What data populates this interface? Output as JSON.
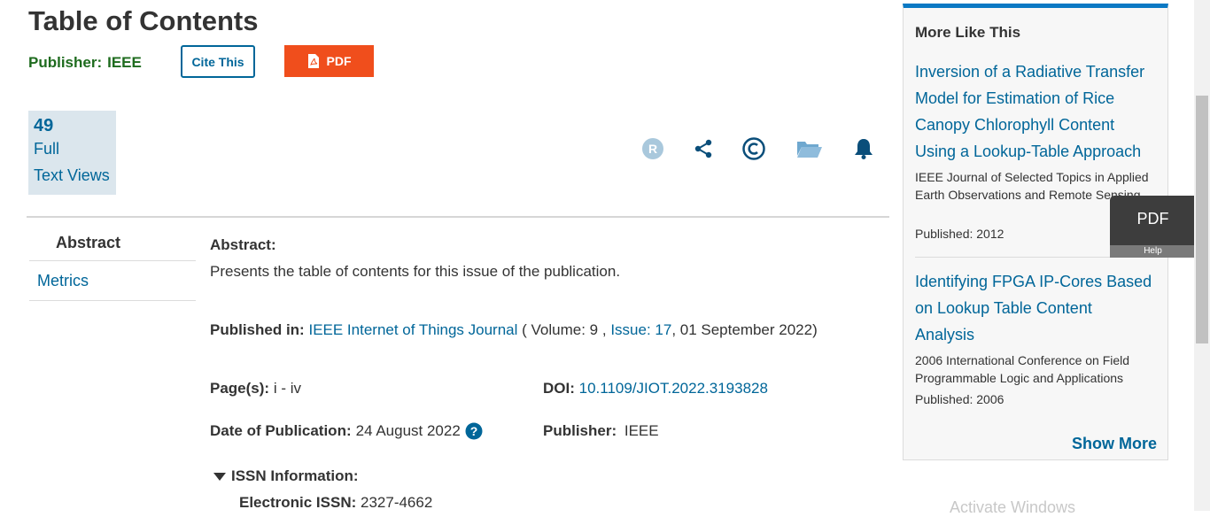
{
  "header": {
    "title": "Table of Contents",
    "publisher_label": "Publisher:",
    "publisher_value": "IEEE",
    "cite_button": "Cite This",
    "pdf_button": "PDF"
  },
  "metrics": {
    "count": "49",
    "label_line1": "Full",
    "label_line2": "Text Views"
  },
  "toolbar_icons": [
    "rights-icon",
    "share-icon",
    "copyright-icon",
    "folder-icon",
    "bell-icon"
  ],
  "nav": {
    "abstract": "Abstract",
    "metrics": "Metrics"
  },
  "abstract": {
    "heading": "Abstract:",
    "text": "Presents the table of contents for this issue of the publication."
  },
  "published_in": {
    "label": "Published in:",
    "journal": "IEEE Internet of Things Journal",
    "open": "( Volume: 9 ,",
    "issue": "Issue: 17",
    "tail": ", 01 September 2022)"
  },
  "details": {
    "pages_label": "Page(s):",
    "pages_value": "i - iv",
    "doi_label": "DOI:",
    "doi_value": "10.1109/JIOT.2022.3193828",
    "date_label": "Date of Publication:",
    "date_value": "24 August 2022",
    "publisher_label": "Publisher:",
    "publisher_value": "IEEE"
  },
  "issn": {
    "toggle_label": "ISSN Information:",
    "electronic_label": "Electronic ISSN:",
    "electronic_value": "2327-4662"
  },
  "more_like_this": {
    "title": "More Like This",
    "items": [
      {
        "line1": "Inversion of a Radiative Transfer",
        "line2": "Model for Estimation of Rice",
        "line3": "Canopy Chlorophyll Content",
        "line4": "Using a Lookup-Table Approach",
        "source": "IEEE Journal of Selected Topics in Applied Earth Observations and Remote Sensing",
        "published": "Published: 2012"
      },
      {
        "line1": "Identifying FPGA IP-Cores Based",
        "line2": "on Lookup Table Content",
        "line3": "Analysis",
        "source": "2006 International Conference on Field Programmable Logic and Applications",
        "published": "Published: 2006"
      }
    ],
    "show_more": "Show More"
  },
  "floating_pdf": {
    "label": "PDF",
    "help": "Help"
  },
  "watermark": "Activate Windows",
  "colors": {
    "link": "#006699",
    "pdf": "#f04e1c",
    "publisher": "#1e6b1e",
    "sidebar_accent": "#0a79c4"
  }
}
